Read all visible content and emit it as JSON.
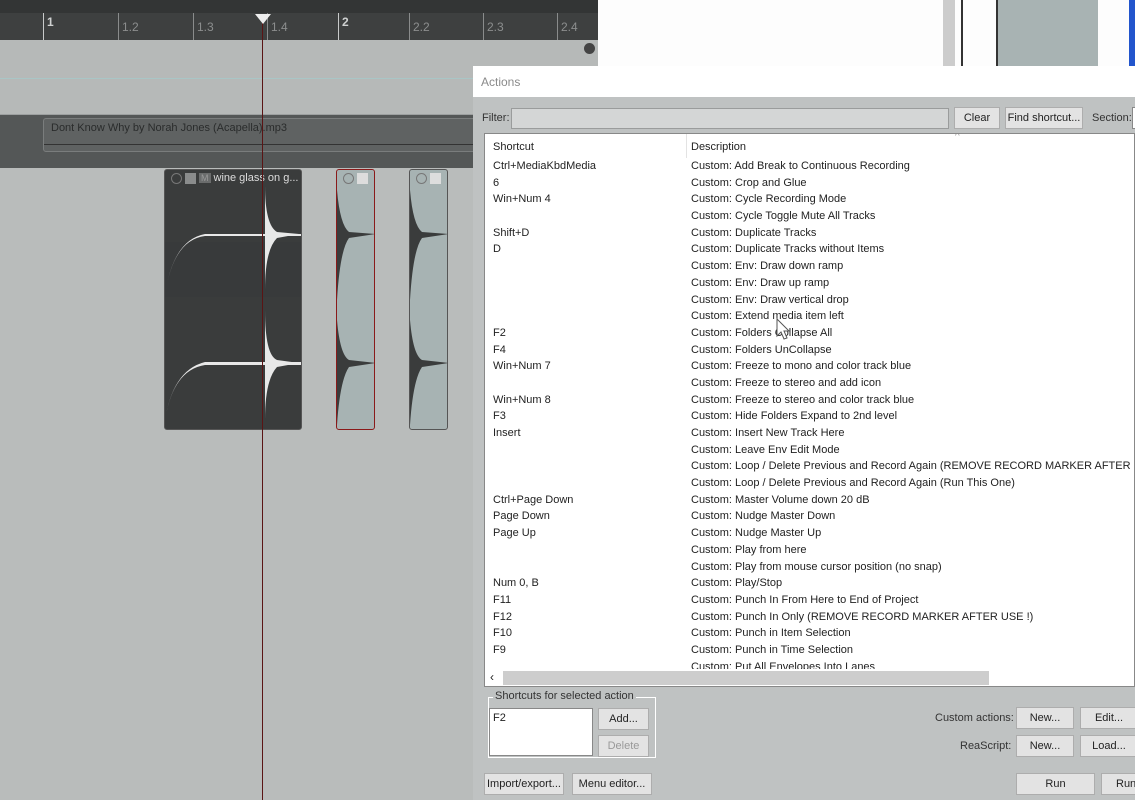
{
  "ruler": {
    "ticks": [
      {
        "label": "1",
        "major": true
      },
      {
        "label": "1.2"
      },
      {
        "label": "1.3"
      },
      {
        "label": "1.4"
      },
      {
        "label": "2",
        "major": true
      },
      {
        "label": "2.2"
      },
      {
        "label": "2.3"
      },
      {
        "label": "2.4"
      }
    ]
  },
  "tracks": {
    "item_name": "Dont Know Why by Norah Jones (Acapella).mp3",
    "clip_name": "wine glass on g...",
    "mute_label": "M"
  },
  "dialog": {
    "title": "Actions",
    "filter_label": "Filter:",
    "filter_value": "",
    "clear": "Clear",
    "find_shortcut": "Find shortcut...",
    "section_label": "Section:",
    "columns": {
      "shortcut": "Shortcut",
      "description": "Description"
    },
    "rows": [
      {
        "s": "Ctrl+MediaKbdMedia",
        "d": "Custom: Add Break to Continuous Recording"
      },
      {
        "s": "6",
        "d": "Custom: Crop and Glue"
      },
      {
        "s": "Win+Num 4",
        "d": "Custom: Cycle Recording Mode"
      },
      {
        "s": "",
        "d": "Custom: Cycle Toggle Mute All Tracks"
      },
      {
        "s": "Shift+D",
        "d": "Custom: Duplicate Tracks"
      },
      {
        "s": "D",
        "d": "Custom: Duplicate Tracks without Items"
      },
      {
        "s": "",
        "d": "Custom: Env: Draw down ramp"
      },
      {
        "s": "",
        "d": "Custom: Env: Draw up ramp"
      },
      {
        "s": "",
        "d": "Custom: Env: Draw vertical drop"
      },
      {
        "s": "",
        "d": "Custom: Extend media item left"
      },
      {
        "s": "F2",
        "d": "Custom: Folders Collapse All"
      },
      {
        "s": "F4",
        "d": "Custom: Folders UnCollapse"
      },
      {
        "s": "Win+Num 7",
        "d": "Custom: Freeze to mono and color track blue"
      },
      {
        "s": "",
        "d": "Custom: Freeze to stereo and add icon"
      },
      {
        "s": "Win+Num 8",
        "d": "Custom: Freeze to stereo and color track blue"
      },
      {
        "s": "F3",
        "d": "Custom: Hide Folders Expand to 2nd level"
      },
      {
        "s": "Insert",
        "d": "Custom: Insert New Track Here"
      },
      {
        "s": "",
        "d": "Custom: Leave Env Edit Mode"
      },
      {
        "s": "",
        "d": "Custom: Loop / Delete Previous and Record Again  (REMOVE RECORD MARKER AFTER USE"
      },
      {
        "s": "",
        "d": "Custom: Loop / Delete Previous and Record Again  (Run This One)"
      },
      {
        "s": "Ctrl+Page Down",
        "d": "Custom: Master Volume down 20 dB"
      },
      {
        "s": "Page Down",
        "d": "Custom: Nudge Master Down"
      },
      {
        "s": "Page Up",
        "d": "Custom: Nudge Master Up"
      },
      {
        "s": "",
        "d": "Custom: Play from here"
      },
      {
        "s": "",
        "d": "Custom: Play from mouse cursor position (no snap)"
      },
      {
        "s": "Num 0, B",
        "d": "Custom: Play/Stop"
      },
      {
        "s": "F11",
        "d": "Custom: Punch In From Here to End of Project"
      },
      {
        "s": "F12",
        "d": "Custom: Punch In Only (REMOVE RECORD MARKER AFTER USE !)"
      },
      {
        "s": "F10",
        "d": "Custom: Punch in Item Selection"
      },
      {
        "s": "F9",
        "d": "Custom: Punch in Time Selection"
      },
      {
        "s": "",
        "d": "Custom: Put All Envelopes Into Lanes"
      }
    ],
    "shortcuts_group": "Shortcuts for selected action",
    "selected_shortcut": "F2",
    "add": "Add...",
    "delete": "Delete",
    "custom_actions_label": "Custom actions:",
    "custom_new": "New...",
    "custom_edit": "Edit...",
    "reascript_label": "ReaScript:",
    "reascript_new": "New...",
    "reascript_load": "Load...",
    "import_export": "Import/export...",
    "menu_editor": "Menu editor...",
    "run": "Run",
    "run2": "Run"
  }
}
